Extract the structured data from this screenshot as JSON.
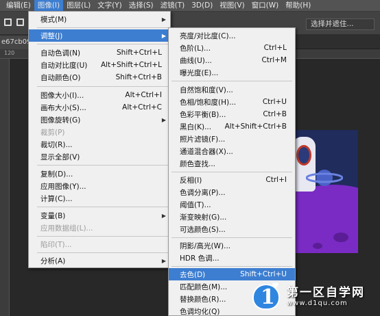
{
  "menubar": {
    "items": [
      {
        "label": "编辑(E)"
      },
      {
        "label": "图像(I)"
      },
      {
        "label": "图层(L)"
      },
      {
        "label": "文字(Y)"
      },
      {
        "label": "选择(S)"
      },
      {
        "label": "滤镜(T)"
      },
      {
        "label": "3D(D)"
      },
      {
        "label": "视图(V)"
      },
      {
        "label": "窗口(W)"
      },
      {
        "label": "帮助(H)"
      }
    ]
  },
  "options_bar": {
    "combine_label": "选择并遮住..."
  },
  "document_tab": {
    "label": "e67cb099"
  },
  "ruler": {
    "marks": [
      "120"
    ]
  },
  "image_menu": {
    "items": [
      {
        "label": "模式(M)",
        "shortcut": ""
      },
      {
        "label": "调整(J)",
        "shortcut": ""
      },
      {
        "label": "自动色调(N)",
        "shortcut": "Shift+Ctrl+L"
      },
      {
        "label": "自动对比度(U)",
        "shortcut": "Alt+Shift+Ctrl+L"
      },
      {
        "label": "自动颜色(O)",
        "shortcut": "Shift+Ctrl+B"
      },
      {
        "label": "图像大小(I)...",
        "shortcut": "Alt+Ctrl+I"
      },
      {
        "label": "画布大小(S)...",
        "shortcut": "Alt+Ctrl+C"
      },
      {
        "label": "图像旋转(G)",
        "shortcut": ""
      },
      {
        "label": "裁剪(P)",
        "shortcut": ""
      },
      {
        "label": "裁切(R)...",
        "shortcut": ""
      },
      {
        "label": "显示全部(V)",
        "shortcut": ""
      },
      {
        "label": "复制(D)...",
        "shortcut": ""
      },
      {
        "label": "应用图像(Y)...",
        "shortcut": ""
      },
      {
        "label": "计算(C)...",
        "shortcut": ""
      },
      {
        "label": "变量(B)",
        "shortcut": ""
      },
      {
        "label": "应用数据组(L)...",
        "shortcut": ""
      },
      {
        "label": "陷印(T)...",
        "shortcut": ""
      },
      {
        "label": "分析(A)",
        "shortcut": ""
      }
    ]
  },
  "adjust_menu": {
    "items": [
      {
        "label": "亮度/对比度(C)...",
        "shortcut": ""
      },
      {
        "label": "色阶(L)...",
        "shortcut": "Ctrl+L"
      },
      {
        "label": "曲线(U)...",
        "shortcut": "Ctrl+M"
      },
      {
        "label": "曝光度(E)...",
        "shortcut": ""
      },
      {
        "label": "自然饱和度(V)...",
        "shortcut": ""
      },
      {
        "label": "色相/饱和度(H)...",
        "shortcut": "Ctrl+U"
      },
      {
        "label": "色彩平衡(B)...",
        "shortcut": "Ctrl+B"
      },
      {
        "label": "黑白(K)...",
        "shortcut": "Alt+Shift+Ctrl+B"
      },
      {
        "label": "照片滤镜(F)...",
        "shortcut": ""
      },
      {
        "label": "通道混合器(X)...",
        "shortcut": ""
      },
      {
        "label": "颜色查找...",
        "shortcut": ""
      },
      {
        "label": "反相(I)",
        "shortcut": "Ctrl+I"
      },
      {
        "label": "色调分离(P)...",
        "shortcut": ""
      },
      {
        "label": "阈值(T)...",
        "shortcut": ""
      },
      {
        "label": "渐变映射(G)...",
        "shortcut": ""
      },
      {
        "label": "可选颜色(S)...",
        "shortcut": ""
      },
      {
        "label": "阴影/高光(W)...",
        "shortcut": ""
      },
      {
        "label": "HDR 色调...",
        "shortcut": ""
      },
      {
        "label": "去色(D)",
        "shortcut": "Shift+Ctrl+U"
      },
      {
        "label": "匹配颜色(M)...",
        "shortcut": ""
      },
      {
        "label": "替换颜色(R)...",
        "shortcut": ""
      },
      {
        "label": "色调均化(Q)",
        "shortcut": ""
      }
    ]
  },
  "watermark": {
    "logo_glyph": "1",
    "title": "第一区自学网",
    "url": "www.d1qu.com"
  },
  "colors": {
    "highlight": "#3d7ed1",
    "menu_bg": "#f0f0f0",
    "menubar_bg": "#535353",
    "watermark_badge": "#2f86e0"
  }
}
